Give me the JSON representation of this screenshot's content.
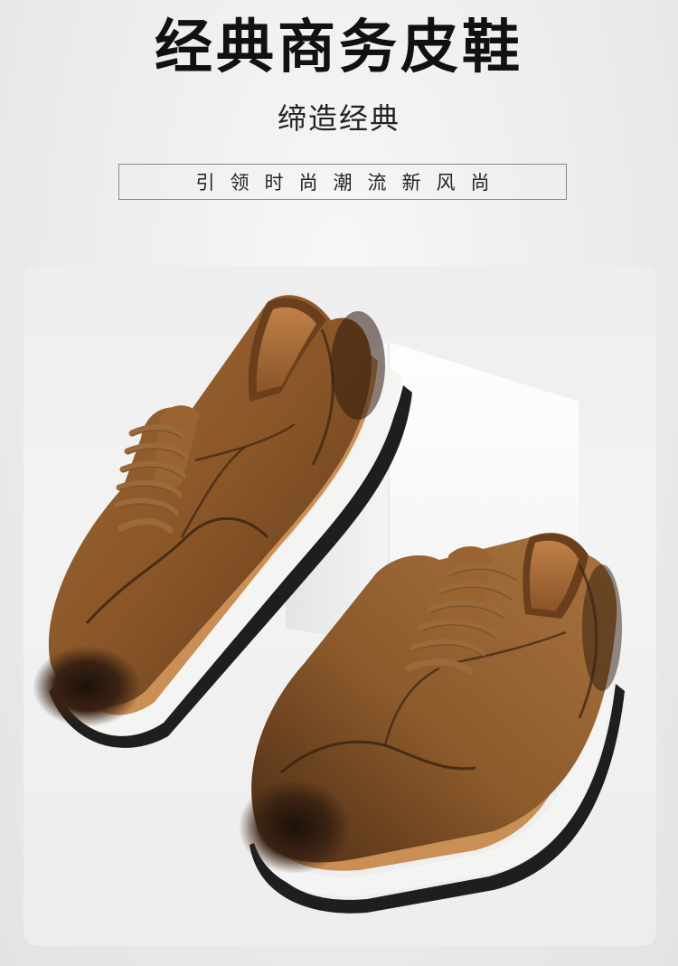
{
  "header": {
    "title": "经典商务皮鞋",
    "subtitle": "缔造经典",
    "tagline": "引领时尚潮流新风尚"
  },
  "product_image": {
    "subject": "brown-leather-sneakers",
    "colors": {
      "leather": "#8a5628",
      "leather_dark": "#3a2212",
      "midsole": "#c98f55",
      "outsole": "#f4f4f2",
      "tread": "#1e1e1e",
      "pedestal": "#fafafa"
    }
  }
}
